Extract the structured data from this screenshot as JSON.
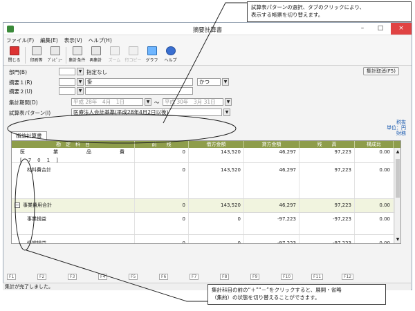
{
  "callouts": {
    "top": [
      "試算表パターンの選択、タブのクリックにより、",
      "表示する帳票を切り替えます。"
    ],
    "bottom": [
      "集計科目の前の“＋”“－”をクリックすると、展開・省略",
      "（集約）の状態を切り替えることができます。"
    ]
  },
  "window": {
    "title": "摘要計算書",
    "minimize": "–",
    "maximize": "□",
    "close": "×"
  },
  "menu": [
    "ファイル(F)",
    "編集(E)",
    "表示(V)",
    "ヘルプ(H)"
  ],
  "toolbar": [
    {
      "label": "閉じる",
      "icon": "close-icon",
      "enabled": true
    },
    {
      "label": "印刷等",
      "icon": "print-icon",
      "enabled": true
    },
    {
      "label": "ﾌﾟﾚﾋﾞｭｰ",
      "icon": "preview-icon",
      "enabled": true
    },
    {
      "label": "集計条件",
      "icon": "conditions-icon",
      "enabled": true
    },
    {
      "label": "再集計",
      "icon": "recalc-icon",
      "enabled": true
    },
    {
      "label": "ズーム",
      "icon": "zoom-icon",
      "enabled": false
    },
    {
      "label": "行コピー",
      "icon": "row-copy-icon",
      "enabled": false
    },
    {
      "label": "グラフ",
      "icon": "graph-icon",
      "enabled": true
    },
    {
      "label": "ヘルプ",
      "icon": "help-icon",
      "enabled": true
    }
  ],
  "form": {
    "dept_label": "部門(B)",
    "dept_value": "指定なし",
    "summary1_label": "摘要１(R)",
    "summary1_value": "掛",
    "summary1_mode": "かつ",
    "summary2_label": "摘要２(U)",
    "period_label": "集計期間(D)",
    "period_from": "平成 28年　4月　1日",
    "period_sep": "～",
    "period_to": "平成 30年　3月 31日",
    "pattern_label": "試算表パターン(I)",
    "pattern_value": "医療法人会計基準(平成28年4月2日以後)",
    "cancel_button": "集計取消(F5)",
    "unit_lines": [
      "税抜",
      "単位：円",
      "財務"
    ]
  },
  "tab": {
    "label": "損益計算書"
  },
  "table": {
    "headers": [
      "勘　定　科　目",
      "前　　残",
      "借方金額",
      "貸方金額",
      "残　　高",
      "構成比"
    ],
    "rows": [
      {
        "name": "医　　業　　品　　費[701]",
        "prev": "0",
        "debit": "143,520",
        "credit": "46,297",
        "balance": "97,223",
        "ratio": "0.00",
        "expander": "",
        "style": "title"
      },
      {
        "name": "材料費合計",
        "prev": "0",
        "debit": "143,520",
        "credit": "46,297",
        "balance": "97,223",
        "ratio": "0.00",
        "expander": "",
        "style": ""
      },
      {
        "name": "事業費用合計",
        "prev": "0",
        "debit": "143,520",
        "credit": "46,297",
        "balance": "97,223",
        "ratio": "0.00",
        "expander": "−",
        "style": "hl"
      },
      {
        "name": "事業損益",
        "prev": "0",
        "debit": "0",
        "credit": "-97,223",
        "balance": "-97,223",
        "ratio": "0.00",
        "expander": "",
        "style": ""
      },
      {
        "name": "経常損益",
        "prev": "0",
        "debit": "0",
        "credit": "-97,223",
        "balance": "-97,223",
        "ratio": "0.00",
        "expander": "",
        "style": ""
      }
    ]
  },
  "fkeys": [
    "F1",
    "F2",
    "F3",
    "F4",
    "F5",
    "F6",
    "F7",
    "F8",
    "F9",
    "F10",
    "F11",
    "F12"
  ],
  "status": "集計が完了しました。"
}
